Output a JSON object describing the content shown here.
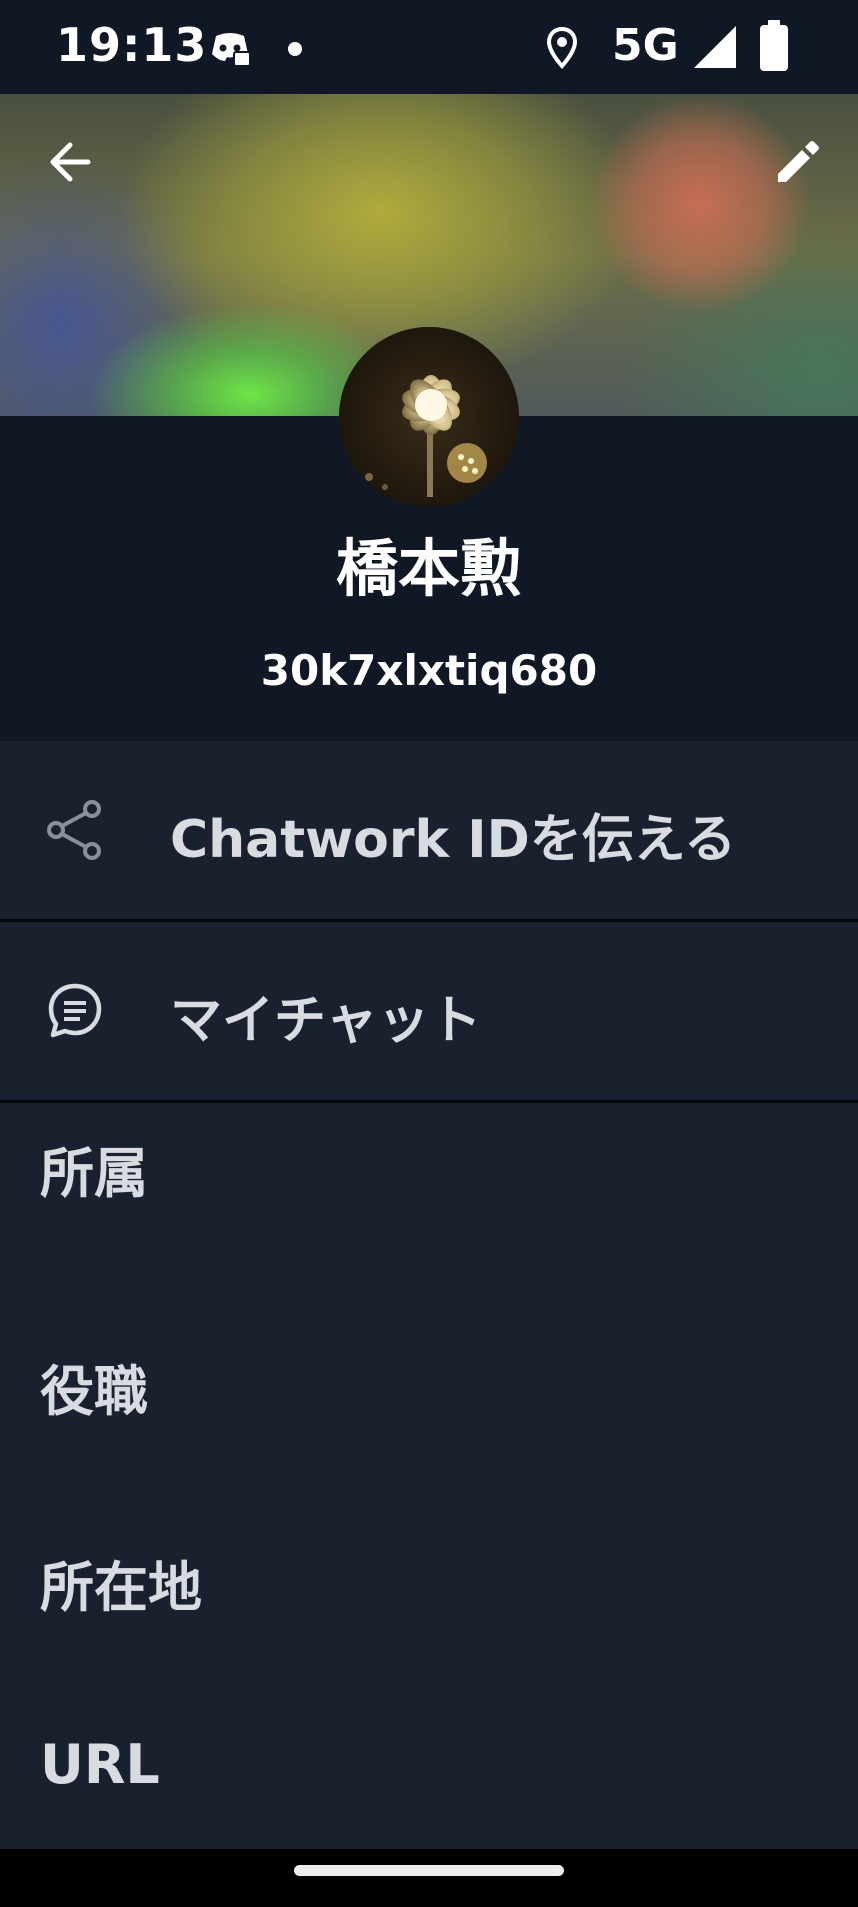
{
  "status_bar": {
    "time": "19:13",
    "network": "5G",
    "icons": [
      "discord-icon",
      "notification-dot",
      "location-icon",
      "signal-icon",
      "battery-icon"
    ]
  },
  "header": {
    "back_icon": "back-arrow-icon",
    "edit_icon": "pencil-icon"
  },
  "profile": {
    "name": "橋本勲",
    "chatwork_id": "30k7xlxtiq680"
  },
  "actions": [
    {
      "icon": "share-icon",
      "label": "Chatwork IDを伝える"
    },
    {
      "icon": "chat-bubble-icon",
      "label": "マイチャット"
    }
  ],
  "fields": {
    "affiliation_label": "所属",
    "title_label": "役職",
    "location_label": "所在地",
    "url_label": "URL"
  },
  "colors": {
    "background": "#101825",
    "row_background": "#19212f",
    "text": "#d8dbe0",
    "divider": "#05080d"
  }
}
